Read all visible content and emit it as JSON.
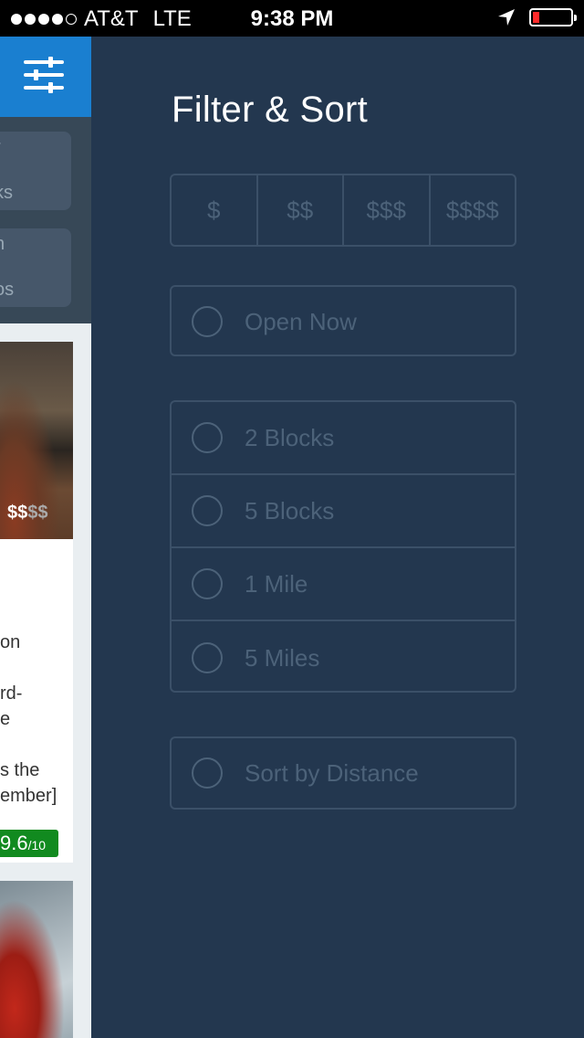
{
  "status_bar": {
    "carrier": "AT&T",
    "network": "LTE",
    "time": "9:38 PM",
    "battery_level": 0.1,
    "signal_bars": 4
  },
  "background_app": {
    "categories": [
      {
        "line1": "r",
        "line2": "ks"
      },
      {
        "line1": "n",
        "line2": "os"
      }
    ],
    "card1": {
      "price": "$$",
      "price_dim": "$$",
      "snippet_lines": [
        "on",
        "rd-",
        "e",
        "s the",
        "ember]"
      ],
      "rating": "9.6",
      "rating_suffix": "/10"
    }
  },
  "filter_panel": {
    "title": "Filter & Sort",
    "price_options": [
      "$",
      "$$",
      "$$$",
      "$$$$"
    ],
    "open_now_label": "Open Now",
    "distance_options": [
      "2 Blocks",
      "5 Blocks",
      "1 Mile",
      "5 Miles"
    ],
    "sort_label": "Sort by Distance"
  },
  "colors": {
    "panel_bg": "#23374f",
    "border": "#3b5068",
    "muted_text": "#4c6279",
    "accent_blue": "#1a7fd0",
    "rating_green": "#118a1f"
  },
  "icons": {
    "filter_button": "sliders-icon",
    "location": "location-arrow-icon",
    "battery": "battery-icon"
  }
}
